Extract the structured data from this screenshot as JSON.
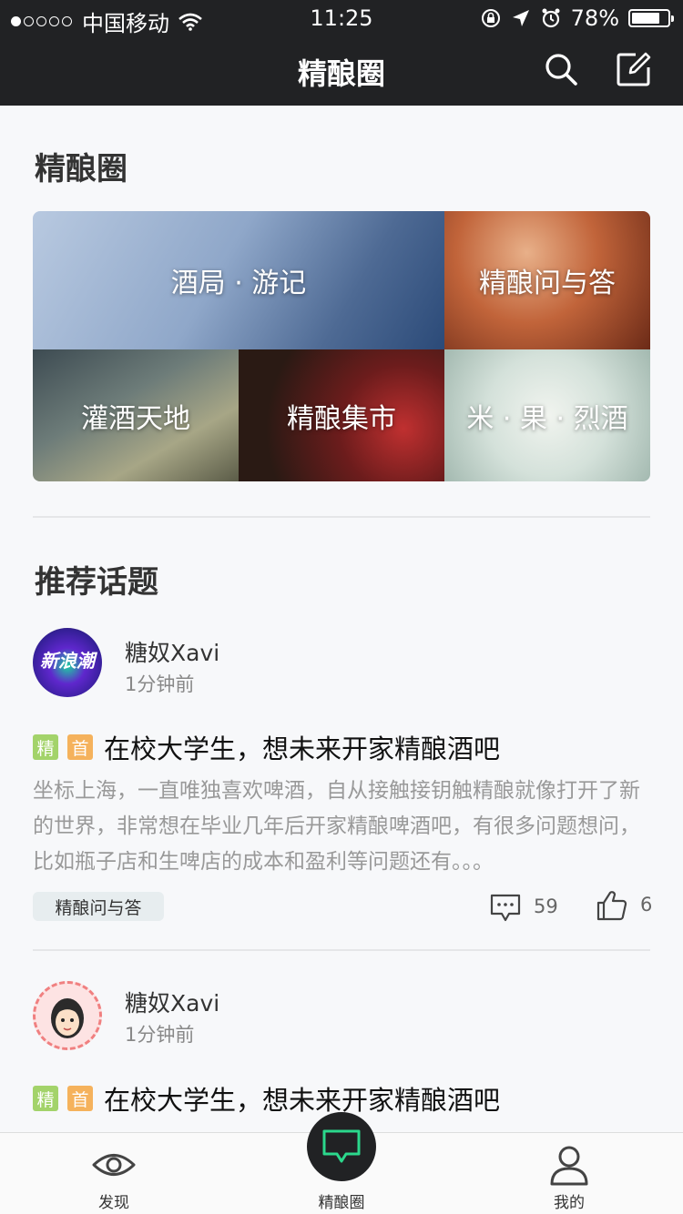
{
  "status_bar": {
    "carrier": "中国移动",
    "time": "11:25",
    "battery": "78%",
    "battery_level": 0.78
  },
  "nav": {
    "title": "精酿圈",
    "search_icon": "search-icon",
    "edit_icon": "edit-icon"
  },
  "circle_section": {
    "title": "精酿圈",
    "categories": [
      {
        "label": "酒局 · 游记"
      },
      {
        "label": "精酿问与答"
      },
      {
        "label": "灌酒天地"
      },
      {
        "label": "精酿集市"
      },
      {
        "label": "米 · 果 · 烈酒"
      }
    ]
  },
  "topics_section": {
    "title": "推荐话题",
    "posts": [
      {
        "username": "糖奴Xavi",
        "time": "1分钟前",
        "avatar_text": "新浪潮",
        "badge_jing": "精",
        "badge_shou": "首",
        "title": "在校大学生，想未来开家精酿酒吧",
        "body": "坐标上海，一直唯独喜欢啤酒，自从接触接钥触精酿就像打开了新的世界，非常想在毕业几年后开家精酿啤酒吧，有很多问题想问，比如瓶子店和生啤店的成本和盈利等问题还有。。。",
        "tag": "精酿问与答",
        "comments": "59",
        "likes": "6"
      },
      {
        "username": "糖奴Xavi",
        "time": "1分钟前",
        "badge_jing": "精",
        "badge_shou": "首",
        "title": "在校大学生，想未来开家精酿酒吧"
      }
    ]
  },
  "tabbar": {
    "tabs": [
      {
        "label": "发现",
        "icon": "eye-icon"
      },
      {
        "label": "精酿圈",
        "icon": "chat-bubble-icon"
      },
      {
        "label": "我的",
        "icon": "user-icon"
      }
    ]
  },
  "colors": {
    "bar_bg": "#212224",
    "badge_jing": "#a3d36a",
    "badge_shou": "#f5b25c",
    "accent_green": "#2bd88c"
  }
}
